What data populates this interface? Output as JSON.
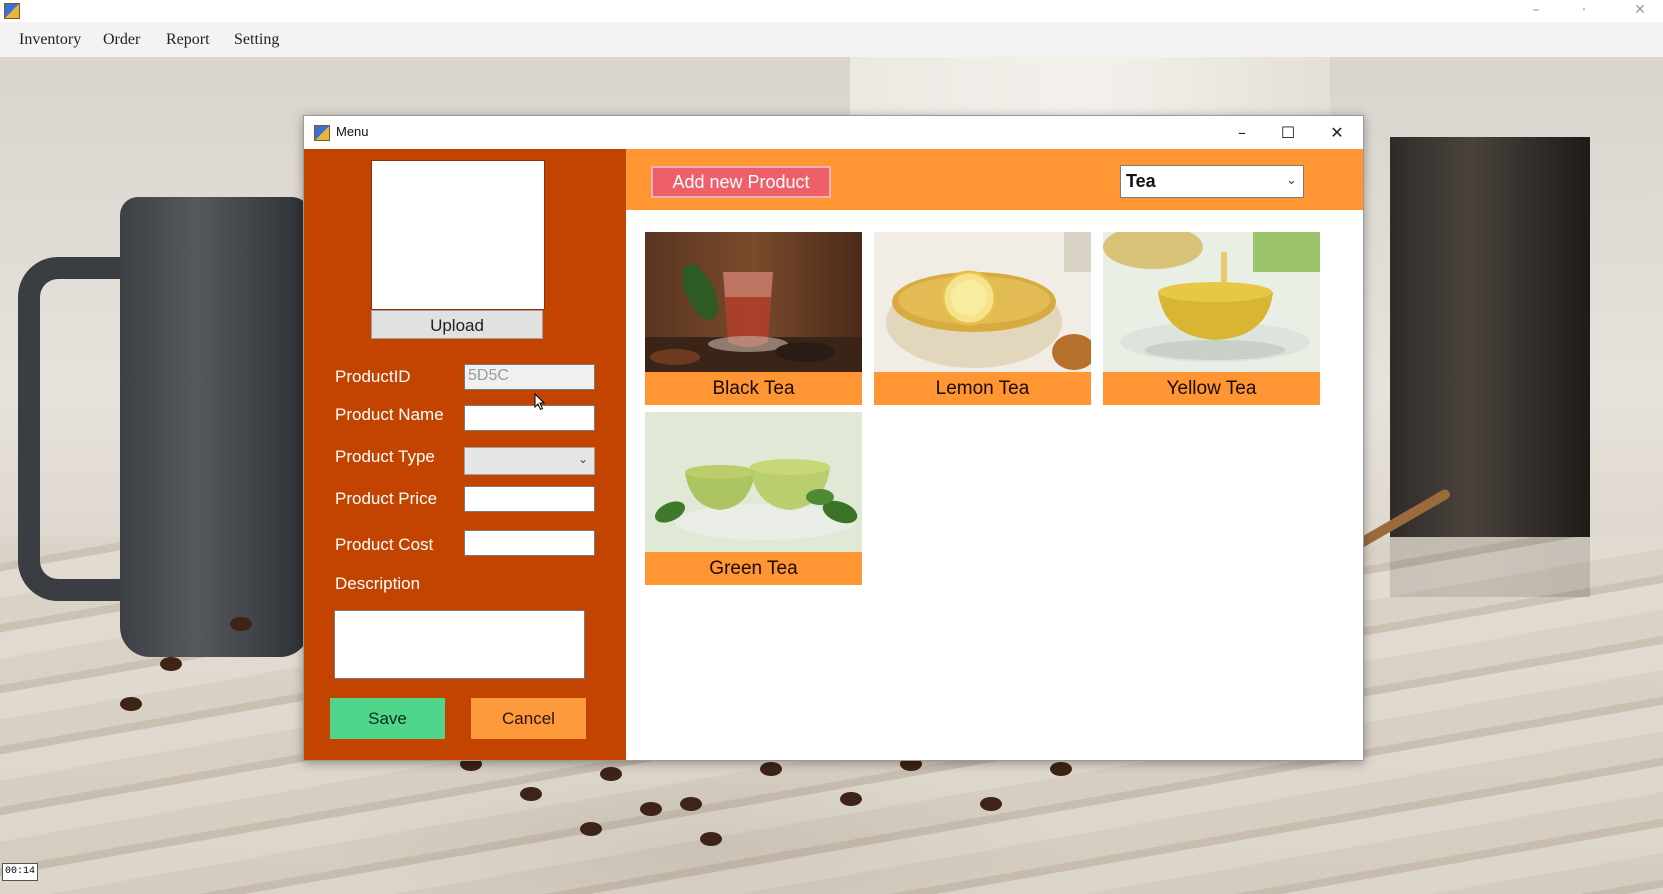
{
  "menubar": {
    "items": [
      "Inventory",
      "Order",
      "Report",
      "Setting"
    ]
  },
  "main_window": {
    "controls": {
      "minimize": "–",
      "maximize": "·",
      "close": "✕"
    }
  },
  "menu_window": {
    "title": "Menu",
    "controls": {
      "minimize": "–",
      "maximize": "☐",
      "close": "✕"
    }
  },
  "form": {
    "upload_label": "Upload",
    "product_id_label": "ProductID",
    "product_id_value": "5D5C",
    "product_name_label": "Product Name",
    "product_name_value": "",
    "product_type_label": "Product Type",
    "product_type_value": "",
    "product_price_label": "Product Price",
    "product_price_value": "",
    "product_cost_label": "Product Cost",
    "product_cost_value": "",
    "description_label": "Description",
    "description_value": "",
    "save_label": "Save",
    "cancel_label": "Cancel"
  },
  "catalog": {
    "add_button_label": "Add new Product",
    "category_selected": "Tea",
    "products": [
      {
        "name": "Black Tea"
      },
      {
        "name": "Lemon Tea"
      },
      {
        "name": "Yellow Tea"
      },
      {
        "name": "Green Tea"
      }
    ]
  },
  "video": {
    "timestamp": "00:14"
  },
  "colors": {
    "left_panel": "#c34401",
    "header_orange": "#ff9533",
    "add_button": "#ef5f6a",
    "save_button": "#4fd68a",
    "cancel_button": "#ff9a3c"
  },
  "icons": {
    "app": "app-icon",
    "chevron": "chevron-down-icon",
    "cursor": "mouse-cursor-icon"
  }
}
